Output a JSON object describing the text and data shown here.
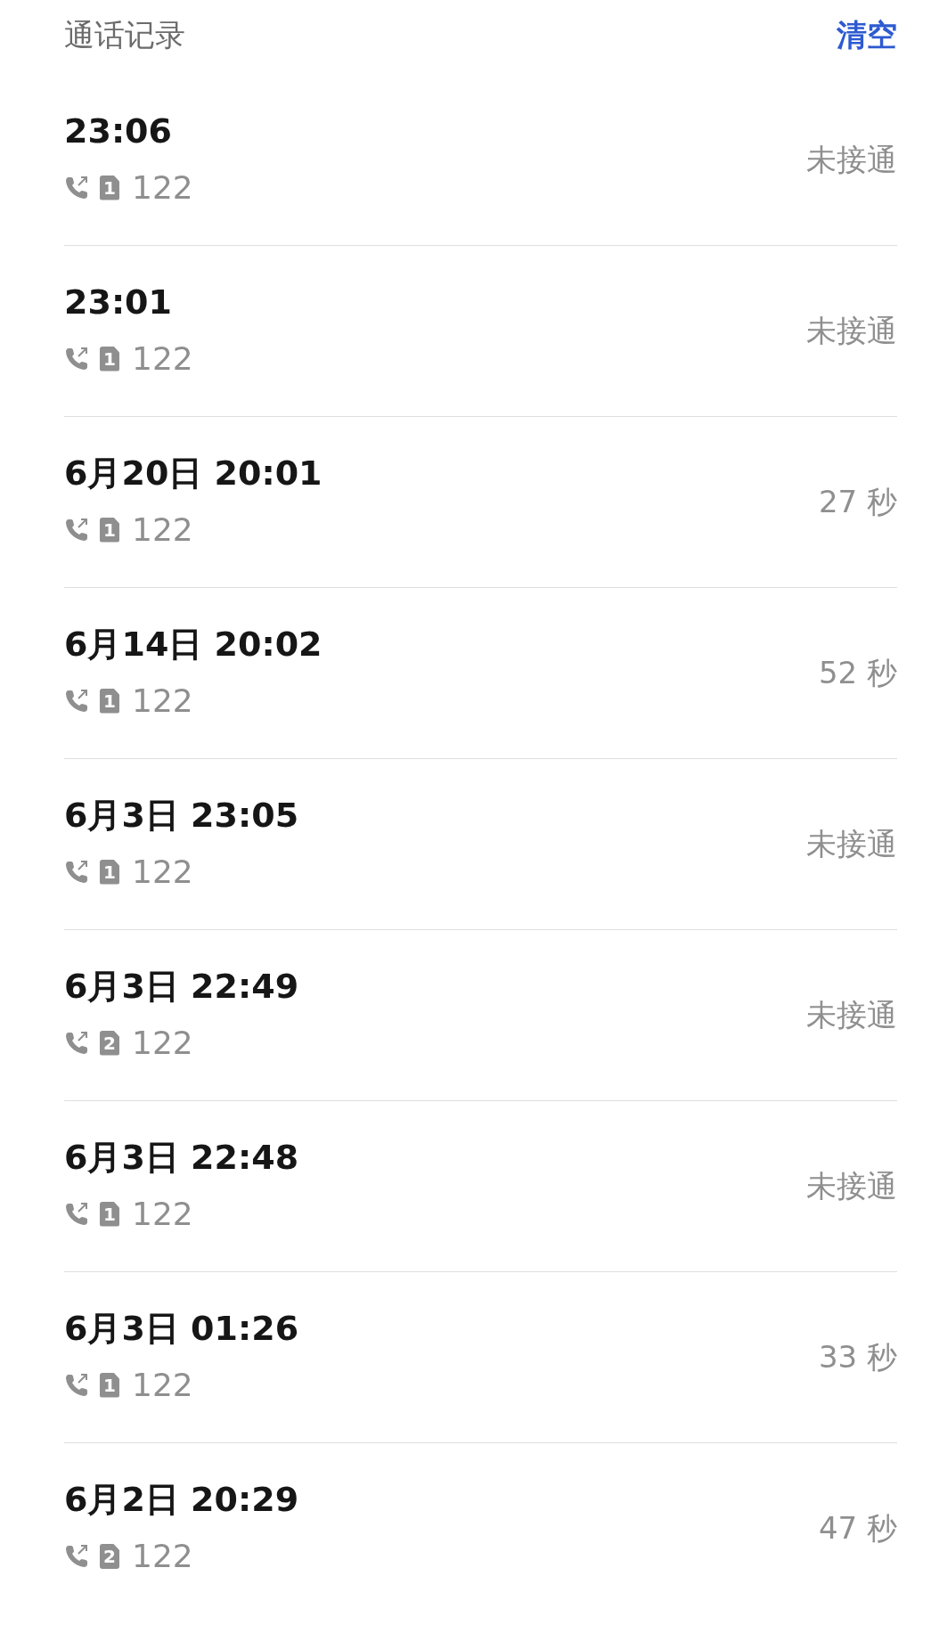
{
  "header": {
    "title": "通话记录",
    "action": "清空"
  },
  "calls": [
    {
      "time": "23:06",
      "sim": "1",
      "number": "122",
      "status": "未接通"
    },
    {
      "time": "23:01",
      "sim": "1",
      "number": "122",
      "status": "未接通"
    },
    {
      "time": "6月20日 20:01",
      "sim": "1",
      "number": "122",
      "status": "27 秒"
    },
    {
      "time": "6月14日 20:02",
      "sim": "1",
      "number": "122",
      "status": "52 秒"
    },
    {
      "time": "6月3日 23:05",
      "sim": "1",
      "number": "122",
      "status": "未接通"
    },
    {
      "time": "6月3日 22:49",
      "sim": "2",
      "number": "122",
      "status": "未接通"
    },
    {
      "time": "6月3日 22:48",
      "sim": "1",
      "number": "122",
      "status": "未接通"
    },
    {
      "time": "6月3日 01:26",
      "sim": "1",
      "number": "122",
      "status": "33 秒"
    },
    {
      "time": "6月2日 20:29",
      "sim": "2",
      "number": "122",
      "status": "47 秒"
    }
  ]
}
